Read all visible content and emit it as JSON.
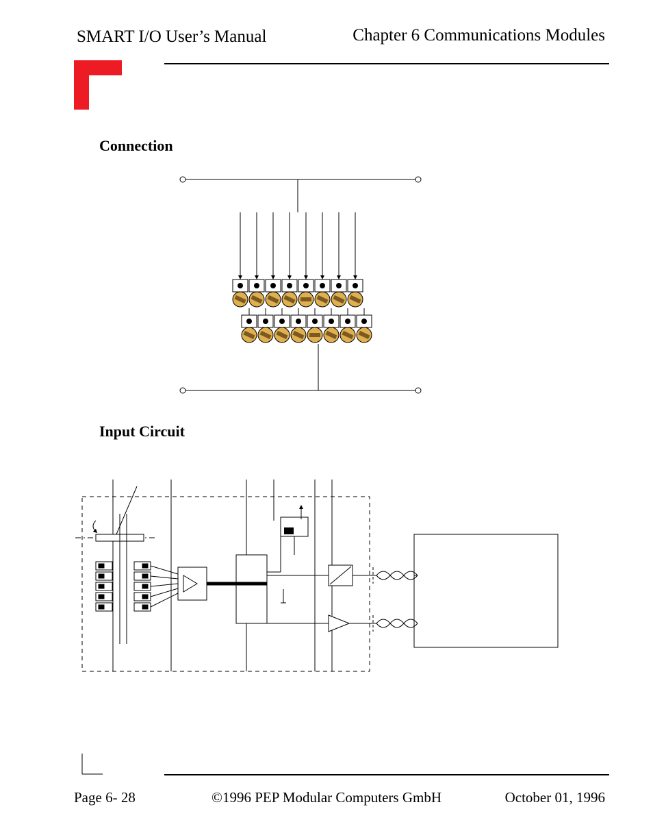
{
  "header": {
    "left": "SMART I/O User’s Manual",
    "right": "Chapter 6  Communications Modules"
  },
  "sections": {
    "connection": "Connection",
    "input_circuit": "Input Circuit"
  },
  "footer": {
    "page": "Page 6- 28",
    "copyright": "©1996 PEP Modular Computers GmbH",
    "date": "October 01, 1996"
  },
  "diagram": {
    "terminal_columns": 8,
    "terminal_rows": 2
  }
}
